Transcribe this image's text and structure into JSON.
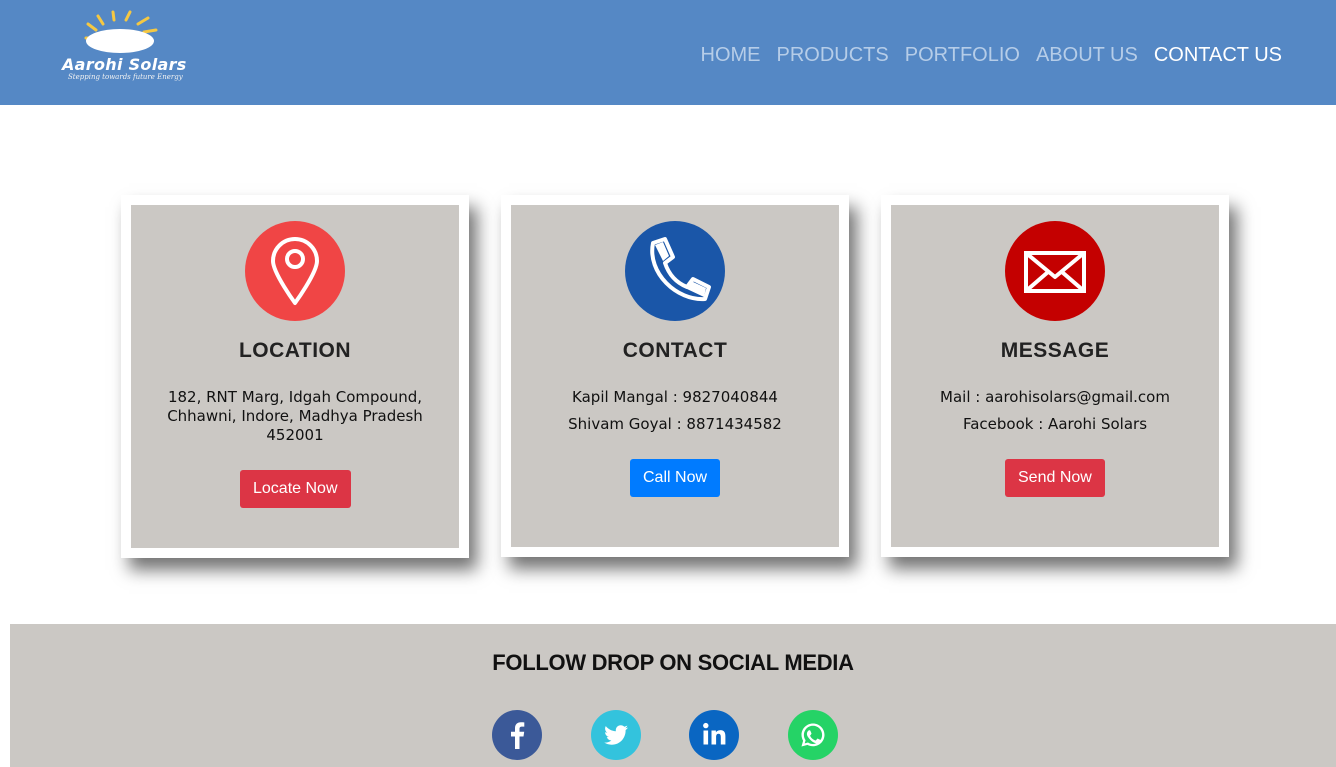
{
  "header": {
    "brand_name": "Aarohi Solars",
    "brand_tagline": "Stepping towards future Energy",
    "nav": [
      {
        "label": "HOME",
        "active": false
      },
      {
        "label": "PRODUCTS",
        "active": false
      },
      {
        "label": "PORTFOLIO",
        "active": false
      },
      {
        "label": "ABOUT US",
        "active": false
      },
      {
        "label": "CONTACT US",
        "active": true
      }
    ]
  },
  "cards": {
    "location": {
      "icon": "map-pin-icon",
      "title": "LOCATION",
      "address": "182, RNT Marg, Idgah Compound, Chhawni, Indore, Madhya Pradesh 452001",
      "button": "Locate Now"
    },
    "contact": {
      "icon": "phone-icon",
      "title": "CONTACT",
      "line1": "Kapil Mangal : 9827040844",
      "line2": "Shivam Goyal : 8871434582",
      "button": "Call Now"
    },
    "message": {
      "icon": "envelope-icon",
      "title": "MESSAGE",
      "line1": "Mail : aarohisolars@gmail.com",
      "line2": "Facebook : Aarohi Solars",
      "button": "Send Now"
    }
  },
  "footer": {
    "title": "FOLLOW DROP ON SOCIAL MEDIA",
    "social": [
      "facebook-icon",
      "twitter-icon",
      "linkedin-icon",
      "whatsapp-icon"
    ]
  },
  "colors": {
    "header_bg": "#5588c5",
    "card_bg": "#cbc8c4",
    "red_button": "#dc3545",
    "blue_button": "#007bff",
    "location_icon": "#f04545",
    "contact_icon": "#1a56a8",
    "message_icon": "#c40000"
  }
}
